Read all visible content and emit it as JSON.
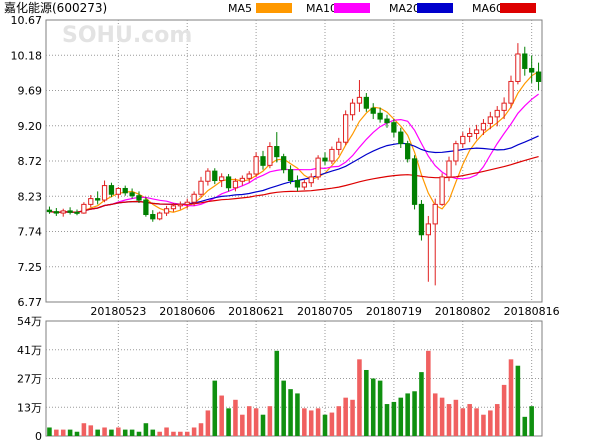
{
  "chart_data": [
    {
      "type": "candlestick",
      "title": "嘉化能源(600273)",
      "watermark": "SOHU.com",
      "y_ticks": [
        "10.67",
        "10.18",
        "9.69",
        "9.20",
        "8.72",
        "8.23",
        "7.74",
        "7.25",
        "6.77"
      ],
      "ylim": [
        6.77,
        10.67
      ],
      "x_tick_labels": [
        "20180523",
        "20180606",
        "20180621",
        "20180705",
        "20180719",
        "20180802",
        "20180816"
      ],
      "x_tick_index": [
        10,
        20,
        30,
        40,
        50,
        60,
        70
      ],
      "grid": true,
      "colors": {
        "up": "#e02020",
        "down": "#007f00",
        "border": "#7f7f7f",
        "grid": "#9a9a9a"
      },
      "legend": [
        {
          "name": "MA5",
          "color": "#ff9900"
        },
        {
          "name": "MA10",
          "color": "#ff00ff"
        },
        {
          "name": "MA20",
          "color": "#0000cc"
        },
        {
          "name": "MA60",
          "color": "#dd0000"
        }
      ],
      "ohlc": [
        [
          8.04,
          8.09,
          7.99,
          8.02
        ],
        [
          8.02,
          8.07,
          7.96,
          8.0
        ],
        [
          8.0,
          8.06,
          7.95,
          8.03
        ],
        [
          8.03,
          8.08,
          7.98,
          8.01
        ],
        [
          8.01,
          8.05,
          7.97,
          8.0
        ],
        [
          8.0,
          8.15,
          7.99,
          8.12
        ],
        [
          8.12,
          8.25,
          8.08,
          8.2
        ],
        [
          8.2,
          8.3,
          8.12,
          8.18
        ],
        [
          8.18,
          8.45,
          8.15,
          8.38
        ],
        [
          8.38,
          8.42,
          8.22,
          8.26
        ],
        [
          8.26,
          8.36,
          8.2,
          8.34
        ],
        [
          8.34,
          8.38,
          8.24,
          8.28
        ],
        [
          8.28,
          8.34,
          8.2,
          8.24
        ],
        [
          8.24,
          8.3,
          8.14,
          8.18
        ],
        [
          8.18,
          8.22,
          7.95,
          7.98
        ],
        [
          7.98,
          8.04,
          7.88,
          7.92
        ],
        [
          7.92,
          8.02,
          7.9,
          8.0
        ],
        [
          8.0,
          8.1,
          7.96,
          8.06
        ],
        [
          8.06,
          8.14,
          8.02,
          8.1
        ],
        [
          8.1,
          8.16,
          8.05,
          8.12
        ],
        [
          8.12,
          8.2,
          8.06,
          8.15
        ],
        [
          8.15,
          8.3,
          8.1,
          8.26
        ],
        [
          8.26,
          8.5,
          8.22,
          8.44
        ],
        [
          8.44,
          8.62,
          8.38,
          8.58
        ],
        [
          8.58,
          8.62,
          8.4,
          8.45
        ],
        [
          8.45,
          8.55,
          8.36,
          8.5
        ],
        [
          8.5,
          8.54,
          8.3,
          8.35
        ],
        [
          8.35,
          8.48,
          8.3,
          8.44
        ],
        [
          8.44,
          8.52,
          8.38,
          8.48
        ],
        [
          8.48,
          8.58,
          8.42,
          8.54
        ],
        [
          8.54,
          8.84,
          8.5,
          8.78
        ],
        [
          8.78,
          8.86,
          8.6,
          8.66
        ],
        [
          8.66,
          8.98,
          8.62,
          8.92
        ],
        [
          8.92,
          9.12,
          8.7,
          8.78
        ],
        [
          8.78,
          8.82,
          8.55,
          8.6
        ],
        [
          8.6,
          8.66,
          8.4,
          8.45
        ],
        [
          8.45,
          8.52,
          8.3,
          8.36
        ],
        [
          8.36,
          8.46,
          8.32,
          8.42
        ],
        [
          8.42,
          8.55,
          8.36,
          8.5
        ],
        [
          8.5,
          8.8,
          8.46,
          8.76
        ],
        [
          8.76,
          8.84,
          8.66,
          8.72
        ],
        [
          8.72,
          8.92,
          8.68,
          8.88
        ],
        [
          8.88,
          9.04,
          8.8,
          8.98
        ],
        [
          8.98,
          9.42,
          8.94,
          9.36
        ],
        [
          9.36,
          9.58,
          9.28,
          9.52
        ],
        [
          9.52,
          9.84,
          9.4,
          9.6
        ],
        [
          9.6,
          9.66,
          9.4,
          9.45
        ],
        [
          9.45,
          9.52,
          9.3,
          9.38
        ],
        [
          9.38,
          9.46,
          9.25,
          9.3
        ],
        [
          9.3,
          9.36,
          9.18,
          9.25
        ],
        [
          9.25,
          9.3,
          9.05,
          9.12
        ],
        [
          9.12,
          9.18,
          8.9,
          8.96
        ],
        [
          8.96,
          9.0,
          8.7,
          8.75
        ],
        [
          8.75,
          8.8,
          8.05,
          8.12
        ],
        [
          8.12,
          8.18,
          7.62,
          7.7
        ],
        [
          7.7,
          7.96,
          7.05,
          7.85
        ],
        [
          7.85,
          8.2,
          7.0,
          8.12
        ],
        [
          8.12,
          8.55,
          8.1,
          8.5
        ],
        [
          8.5,
          8.78,
          8.44,
          8.72
        ],
        [
          8.72,
          9.0,
          8.66,
          8.96
        ],
        [
          8.96,
          9.12,
          8.9,
          9.06
        ],
        [
          9.06,
          9.18,
          8.98,
          9.1
        ],
        [
          9.1,
          9.22,
          9.02,
          9.15
        ],
        [
          9.15,
          9.3,
          9.08,
          9.24
        ],
        [
          9.24,
          9.4,
          9.16,
          9.33
        ],
        [
          9.33,
          9.48,
          9.2,
          9.42
        ],
        [
          9.42,
          9.6,
          9.3,
          9.52
        ],
        [
          9.52,
          9.9,
          9.45,
          9.82
        ],
        [
          9.82,
          10.35,
          9.78,
          10.2
        ],
        [
          10.2,
          10.3,
          9.9,
          10.0
        ],
        [
          10.0,
          10.18,
          9.8,
          9.95
        ],
        [
          9.95,
          10.08,
          9.7,
          9.82
        ]
      ]
    },
    {
      "type": "bar",
      "title": "",
      "y_ticks": [
        "54万",
        "41万",
        "27万",
        "13万",
        "0"
      ],
      "ylim": [
        0,
        54
      ],
      "unit": "万",
      "grid": true,
      "values": [
        4,
        3,
        3,
        3,
        2,
        6,
        5,
        3,
        4,
        3,
        4,
        3,
        3,
        2,
        6,
        3,
        2,
        4,
        2,
        2,
        2,
        4,
        6,
        12,
        26,
        19,
        13,
        17,
        10,
        14,
        13,
        10,
        14,
        40,
        26,
        22,
        20,
        13,
        12,
        13,
        10,
        11,
        14,
        18,
        17,
        36,
        31,
        27,
        26,
        15,
        16,
        18,
        20,
        21,
        30,
        40,
        20,
        18,
        15,
        17,
        13,
        15,
        13,
        10,
        12,
        15,
        24,
        36,
        33,
        9,
        14
      ],
      "up": [
        0,
        1,
        1,
        0,
        0,
        1,
        1,
        0,
        1,
        0,
        1,
        0,
        0,
        0,
        0,
        0,
        1,
        1,
        1,
        1,
        1,
        1,
        1,
        1,
        0,
        1,
        0,
        1,
        1,
        1,
        1,
        0,
        1,
        0,
        0,
        0,
        0,
        1,
        1,
        1,
        0,
        1,
        1,
        1,
        1,
        1,
        0,
        0,
        0,
        0,
        0,
        0,
        0,
        0,
        0,
        1,
        1,
        1,
        1,
        1,
        1,
        1,
        1,
        1,
        1,
        1,
        1,
        1,
        0,
        0,
        0
      ]
    }
  ]
}
